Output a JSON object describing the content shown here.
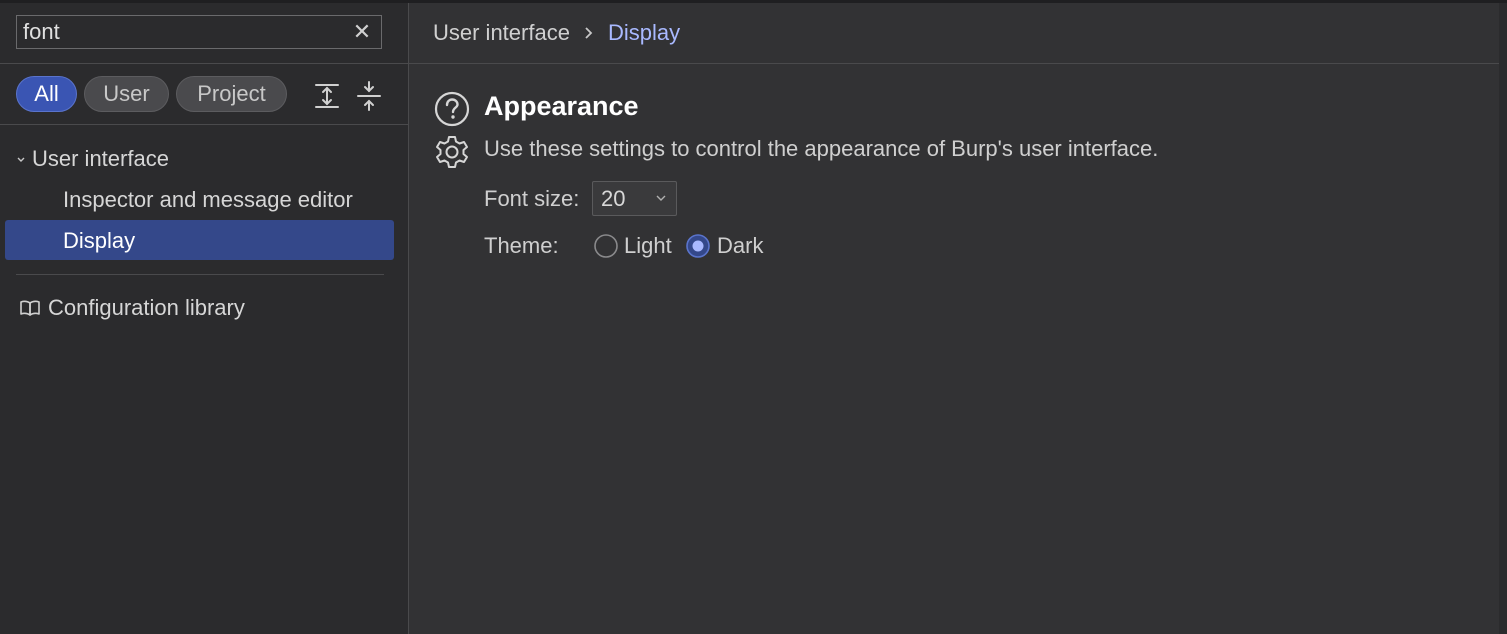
{
  "search": {
    "value": "font",
    "clear_icon": "close-icon"
  },
  "filters": {
    "all": "All",
    "user": "User",
    "project": "Project",
    "active": "All"
  },
  "tools": {
    "expand_icon": "expand-all-icon",
    "collapse_icon": "collapse-all-icon"
  },
  "tree": {
    "group_label": "User interface",
    "children": [
      "Inspector and message editor",
      "Display"
    ],
    "selected": "Display"
  },
  "library": {
    "label": "Configuration library",
    "icon": "book-icon"
  },
  "breadcrumb": {
    "parent": "User interface",
    "current": "Display"
  },
  "section": {
    "title": "Appearance",
    "description": "Use these settings to control the appearance of Burp's user interface.",
    "help_icon": "help-icon",
    "settings_icon": "gear-icon"
  },
  "font_size": {
    "label": "Font size:",
    "value": "20"
  },
  "theme": {
    "label": "Theme:",
    "options": [
      "Light",
      "Dark"
    ],
    "selected": "Dark"
  },
  "colors": {
    "accent": "#3a55b3",
    "selection": "#34488a",
    "link": "#a9b9ff",
    "background": "#2b2b2d"
  }
}
